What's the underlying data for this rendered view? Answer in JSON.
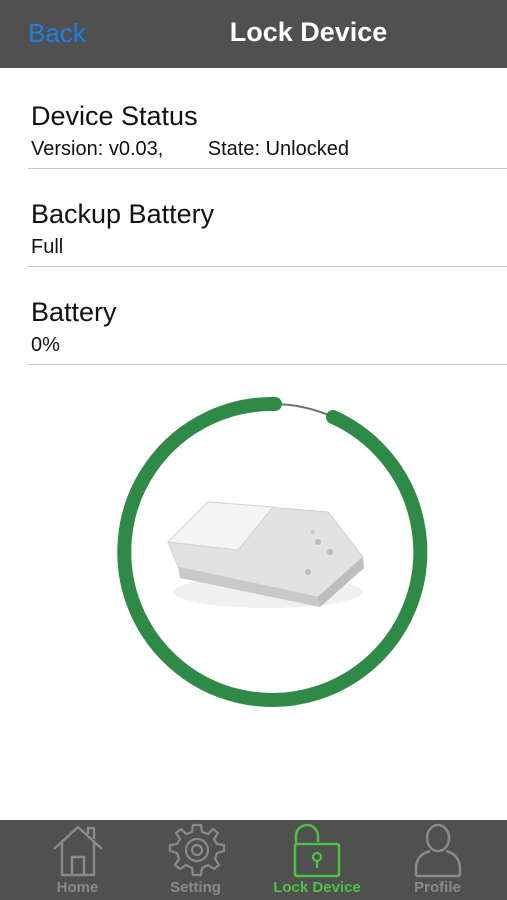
{
  "navbar": {
    "back_label": "Back",
    "title": "Lock Device"
  },
  "sections": [
    {
      "title": "Device Status",
      "value": "Version: v0.03,        State: Unlocked"
    },
    {
      "title": "Backup Battery",
      "value": "Full"
    },
    {
      "title": "Battery",
      "value": "0%"
    }
  ],
  "ring": {
    "color": "#2e8a46",
    "track_color": "#707070",
    "icon": "lock-device-icon"
  },
  "tabs": [
    {
      "label": "Home",
      "icon": "home-icon",
      "active": false
    },
    {
      "label": "Setting",
      "icon": "gear-icon",
      "active": false
    },
    {
      "label": "Lock Device",
      "icon": "unlock-icon",
      "active": true
    },
    {
      "label": "Profile",
      "icon": "user-icon",
      "active": false
    }
  ],
  "colors": {
    "nav_bg": "#505050",
    "accent_blue": "#1e7ee6",
    "active_green": "#4cc443"
  }
}
